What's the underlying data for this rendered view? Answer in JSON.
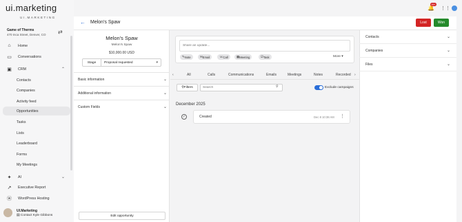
{
  "brand": {
    "name": "ui.marketing",
    "sub": "UI.MARKETING"
  },
  "account": {
    "name": "Game of Therms",
    "address": "470 Inca Street, Denver, CO"
  },
  "nav": {
    "home": "Home",
    "conversations": "Conversations",
    "crm": "CRM",
    "crm_items": [
      "Contacts",
      "Companies",
      "Activity feed",
      "Opportunities",
      "Tasks",
      "Lists",
      "Leaderboard",
      "Forms",
      "My Meetings"
    ],
    "ai": "AI",
    "executive_report": "Executive Report",
    "wordpress": "WordPress Hosting"
  },
  "user": {
    "name": "UI.Marketing",
    "contact": "Contact Kyle Gibbons"
  },
  "topbar": {
    "badge": "99+",
    "title": "Melon's Spaw",
    "lost": "Lost",
    "won": "Won"
  },
  "deal": {
    "name": "Melon's Spaw",
    "company": "Melon's Spaw",
    "amount": "$10,000.00 USD",
    "stage_label": "Stage",
    "stage_value": "Proposal requested"
  },
  "sections": [
    "Basic information",
    "Additional information",
    "Custom Fields"
  ],
  "edit_button": "Edit opportunity",
  "composer": {
    "placeholder": "Share an update...",
    "chips": [
      "Note",
      "Email",
      "Call",
      "Meeting",
      "Task"
    ],
    "more": "More"
  },
  "tabs": [
    "All",
    "Calls",
    "Communications",
    "Emails",
    "Meetings",
    "Notes",
    "Recorded"
  ],
  "filters": {
    "label": "Filters",
    "search_placeholder": "Search",
    "exclude": "Exclude campaigns"
  },
  "feed": {
    "month": "December 2025",
    "items": [
      {
        "label": "Created",
        "timestamp": "Dec 8 10:38 AM"
      }
    ]
  },
  "right_sections": [
    "Contacts",
    "Companies",
    "Files"
  ],
  "colors": {
    "lost": "#d32424",
    "won": "#258a2c",
    "accent": "#2a6ed8"
  }
}
